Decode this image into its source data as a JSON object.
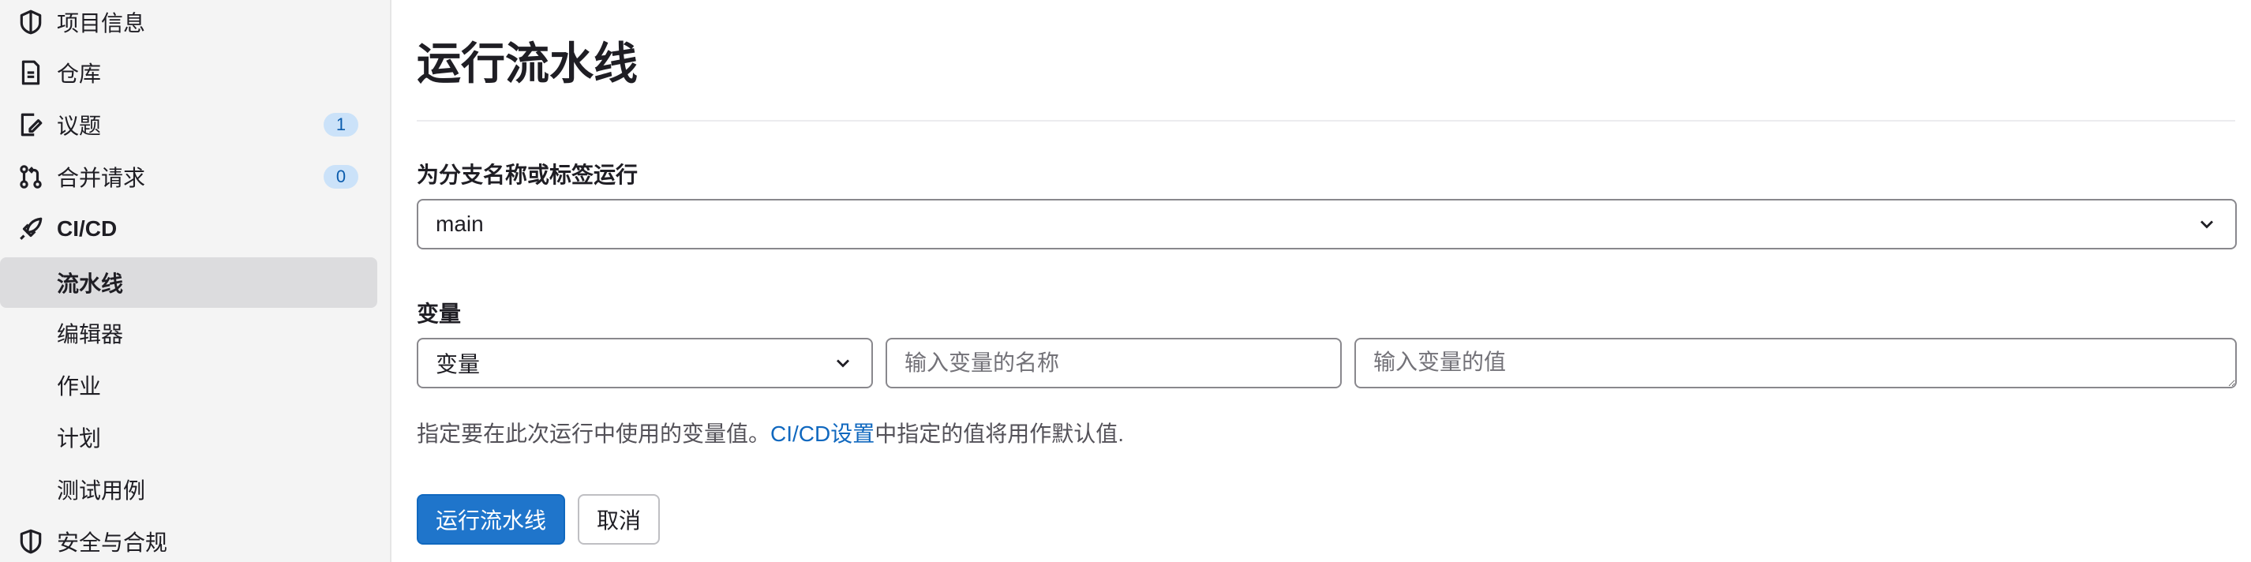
{
  "sidebar": {
    "items": [
      {
        "label": "项目信息",
        "icon": "project-info-icon"
      },
      {
        "label": "仓库",
        "icon": "repository-icon"
      },
      {
        "label": "议题",
        "icon": "issues-icon",
        "badge": "1"
      },
      {
        "label": "合并请求",
        "icon": "merge-request-icon",
        "badge": "0"
      },
      {
        "label": "CI/CD",
        "icon": "rocket-icon"
      },
      {
        "label": "流水线",
        "active": true
      },
      {
        "label": "编辑器"
      },
      {
        "label": "作业"
      },
      {
        "label": "计划"
      },
      {
        "label": "测试用例"
      },
      {
        "label": "安全与合规",
        "icon": "shield-icon"
      }
    ]
  },
  "main": {
    "title": "运行流水线",
    "branch": {
      "label": "为分支名称或标签运行",
      "value": "main"
    },
    "variables": {
      "label": "变量",
      "type_value": "变量",
      "key_placeholder": "输入变量的名称",
      "value_placeholder": "输入变量的值"
    },
    "help": {
      "before": "指定要在此次运行中使用的变量值。",
      "link": "CI/CD设置",
      "after": "中指定的值将用作默认值."
    },
    "buttons": {
      "run": "运行流水线",
      "cancel": "取消"
    }
  },
  "colors": {
    "primary": "#1f75cb",
    "link": "#1068bf",
    "badge_bg": "#cbe2f9",
    "sidebar_bg": "#f4f4f4",
    "active_bg": "#dcdcde"
  }
}
